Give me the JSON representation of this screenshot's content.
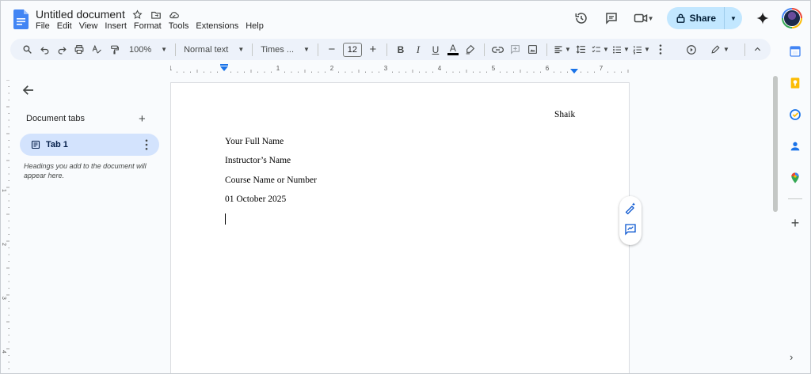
{
  "app": {
    "doc_title": "Untitled document",
    "menu": [
      "File",
      "Edit",
      "View",
      "Insert",
      "Format",
      "Tools",
      "Extensions",
      "Help"
    ]
  },
  "header": {
    "share_label": "Share",
    "icons": [
      "history-icon",
      "comment-icon",
      "meet-icon",
      "gemini-icon",
      "avatar"
    ]
  },
  "toolbar": {
    "zoom": "100%",
    "style": "Normal text",
    "font": "Times ...",
    "font_size": "12",
    "bold": "B",
    "italic": "I",
    "underline": "U",
    "text_color": "A"
  },
  "ruler": {
    "labels": [
      "1",
      "1",
      "2",
      "3",
      "4",
      "5",
      "6",
      "7"
    ],
    "vlabels": [
      "1",
      "2",
      "3",
      "4"
    ]
  },
  "sidebar": {
    "heading": "Document tabs",
    "tab_label": "Tab 1",
    "hint": "Headings you add to the document will appear here."
  },
  "document": {
    "header_right": "Shaik",
    "lines": [
      "Your Full Name",
      "Instructor’s Name",
      "Course Name or Number",
      "01 October 2025"
    ]
  },
  "colors": {
    "share_bg": "#c2e7ff",
    "tab_active_bg": "#d3e3fd",
    "toolbar_bg": "#edf2fa",
    "docs_blue": "#4285f4"
  }
}
